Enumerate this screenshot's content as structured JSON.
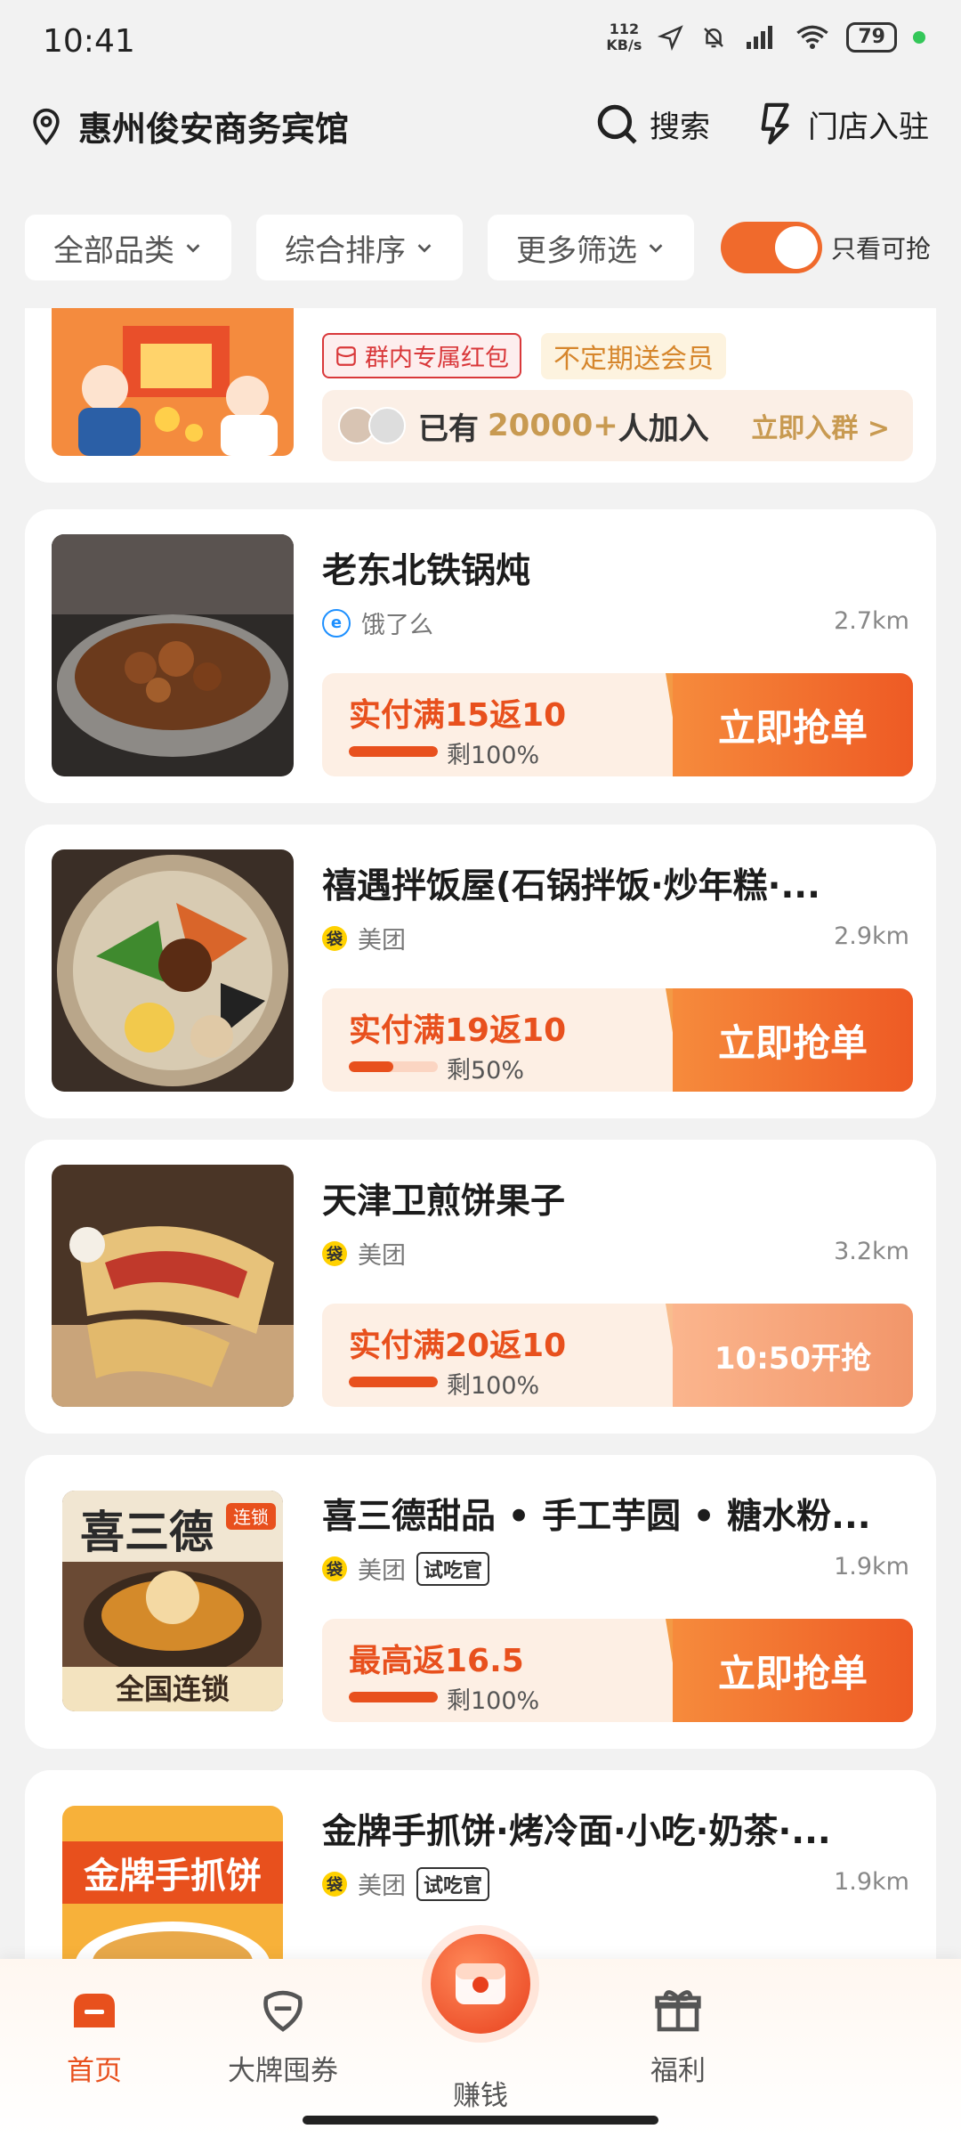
{
  "status_bar": {
    "time": "10:41",
    "net_speed_value": "112",
    "net_speed_unit": "KB/s",
    "battery": "79"
  },
  "header": {
    "location": "惠州俊安商务宾馆",
    "search_label": "搜索",
    "store_label": "门店入驻"
  },
  "filters": {
    "category": "全部品类",
    "sort": "综合排序",
    "more": "更多筛选",
    "toggle_label": "只看可抢",
    "toggle_on": true
  },
  "promo": {
    "tag_red": "群内专属红包",
    "tag_gold": "不定期送会员",
    "joined_prefix": "已有",
    "joined_count": "20000+",
    "joined_suffix": "人加入",
    "join_cta": "立即入群 >"
  },
  "listings": [
    {
      "name": "老东北铁锅炖",
      "platform": "饿了么",
      "platform_badge": "elm",
      "distance": "2.7km",
      "deal": "实付满15返10",
      "remaining_label": "剩100%",
      "remaining": 1.0,
      "cta": "立即抢单",
      "cta_state": "active"
    },
    {
      "name": "禧遇拌饭屋(石锅拌饭·炒年糕·...",
      "platform": "美团",
      "platform_badge": "meituan",
      "distance": "2.9km",
      "deal": "实付满19返10",
      "remaining_label": "剩50%",
      "remaining": 0.5,
      "cta": "立即抢单",
      "cta_state": "active"
    },
    {
      "name": "天津卫煎饼果子",
      "platform": "美团",
      "platform_badge": "meituan",
      "distance": "3.2km",
      "deal": "实付满20返10",
      "remaining_label": "剩100%",
      "remaining": 1.0,
      "cta": "10:50开抢",
      "cta_state": "pending"
    },
    {
      "name": "喜三德甜品 • 手工芋圆 • 糖水粉...",
      "platform": "美团",
      "platform_badge": "meituan",
      "extra_tag": "试吃官",
      "distance": "1.9km",
      "deal": "最高返16.5",
      "remaining_label": "剩100%",
      "remaining": 1.0,
      "cta": "立即抢单",
      "cta_state": "active",
      "thumb_text": "全国连锁",
      "thumb_badge": "连锁"
    },
    {
      "name": "金牌手抓饼·烤冷面·小吃·奶茶·...",
      "platform": "美团",
      "platform_badge": "meituan",
      "extra_tag": "试吃官",
      "distance": "1.9km",
      "thumb_text": "金牌手抓饼"
    }
  ],
  "tabs": [
    {
      "label": "首页",
      "icon": "home-icon",
      "active": true
    },
    {
      "label": "大牌囤券",
      "icon": "coupon-icon",
      "active": false
    },
    {
      "label": "赚钱",
      "icon": "earn-icon",
      "active": false
    },
    {
      "label": "福利",
      "icon": "gift-icon",
      "active": false
    }
  ],
  "colors": {
    "accent": "#e8501d",
    "cta_gradient_start": "#f68b3c",
    "deal_bg": "#fdefe4",
    "background": "#f2f2f2"
  }
}
